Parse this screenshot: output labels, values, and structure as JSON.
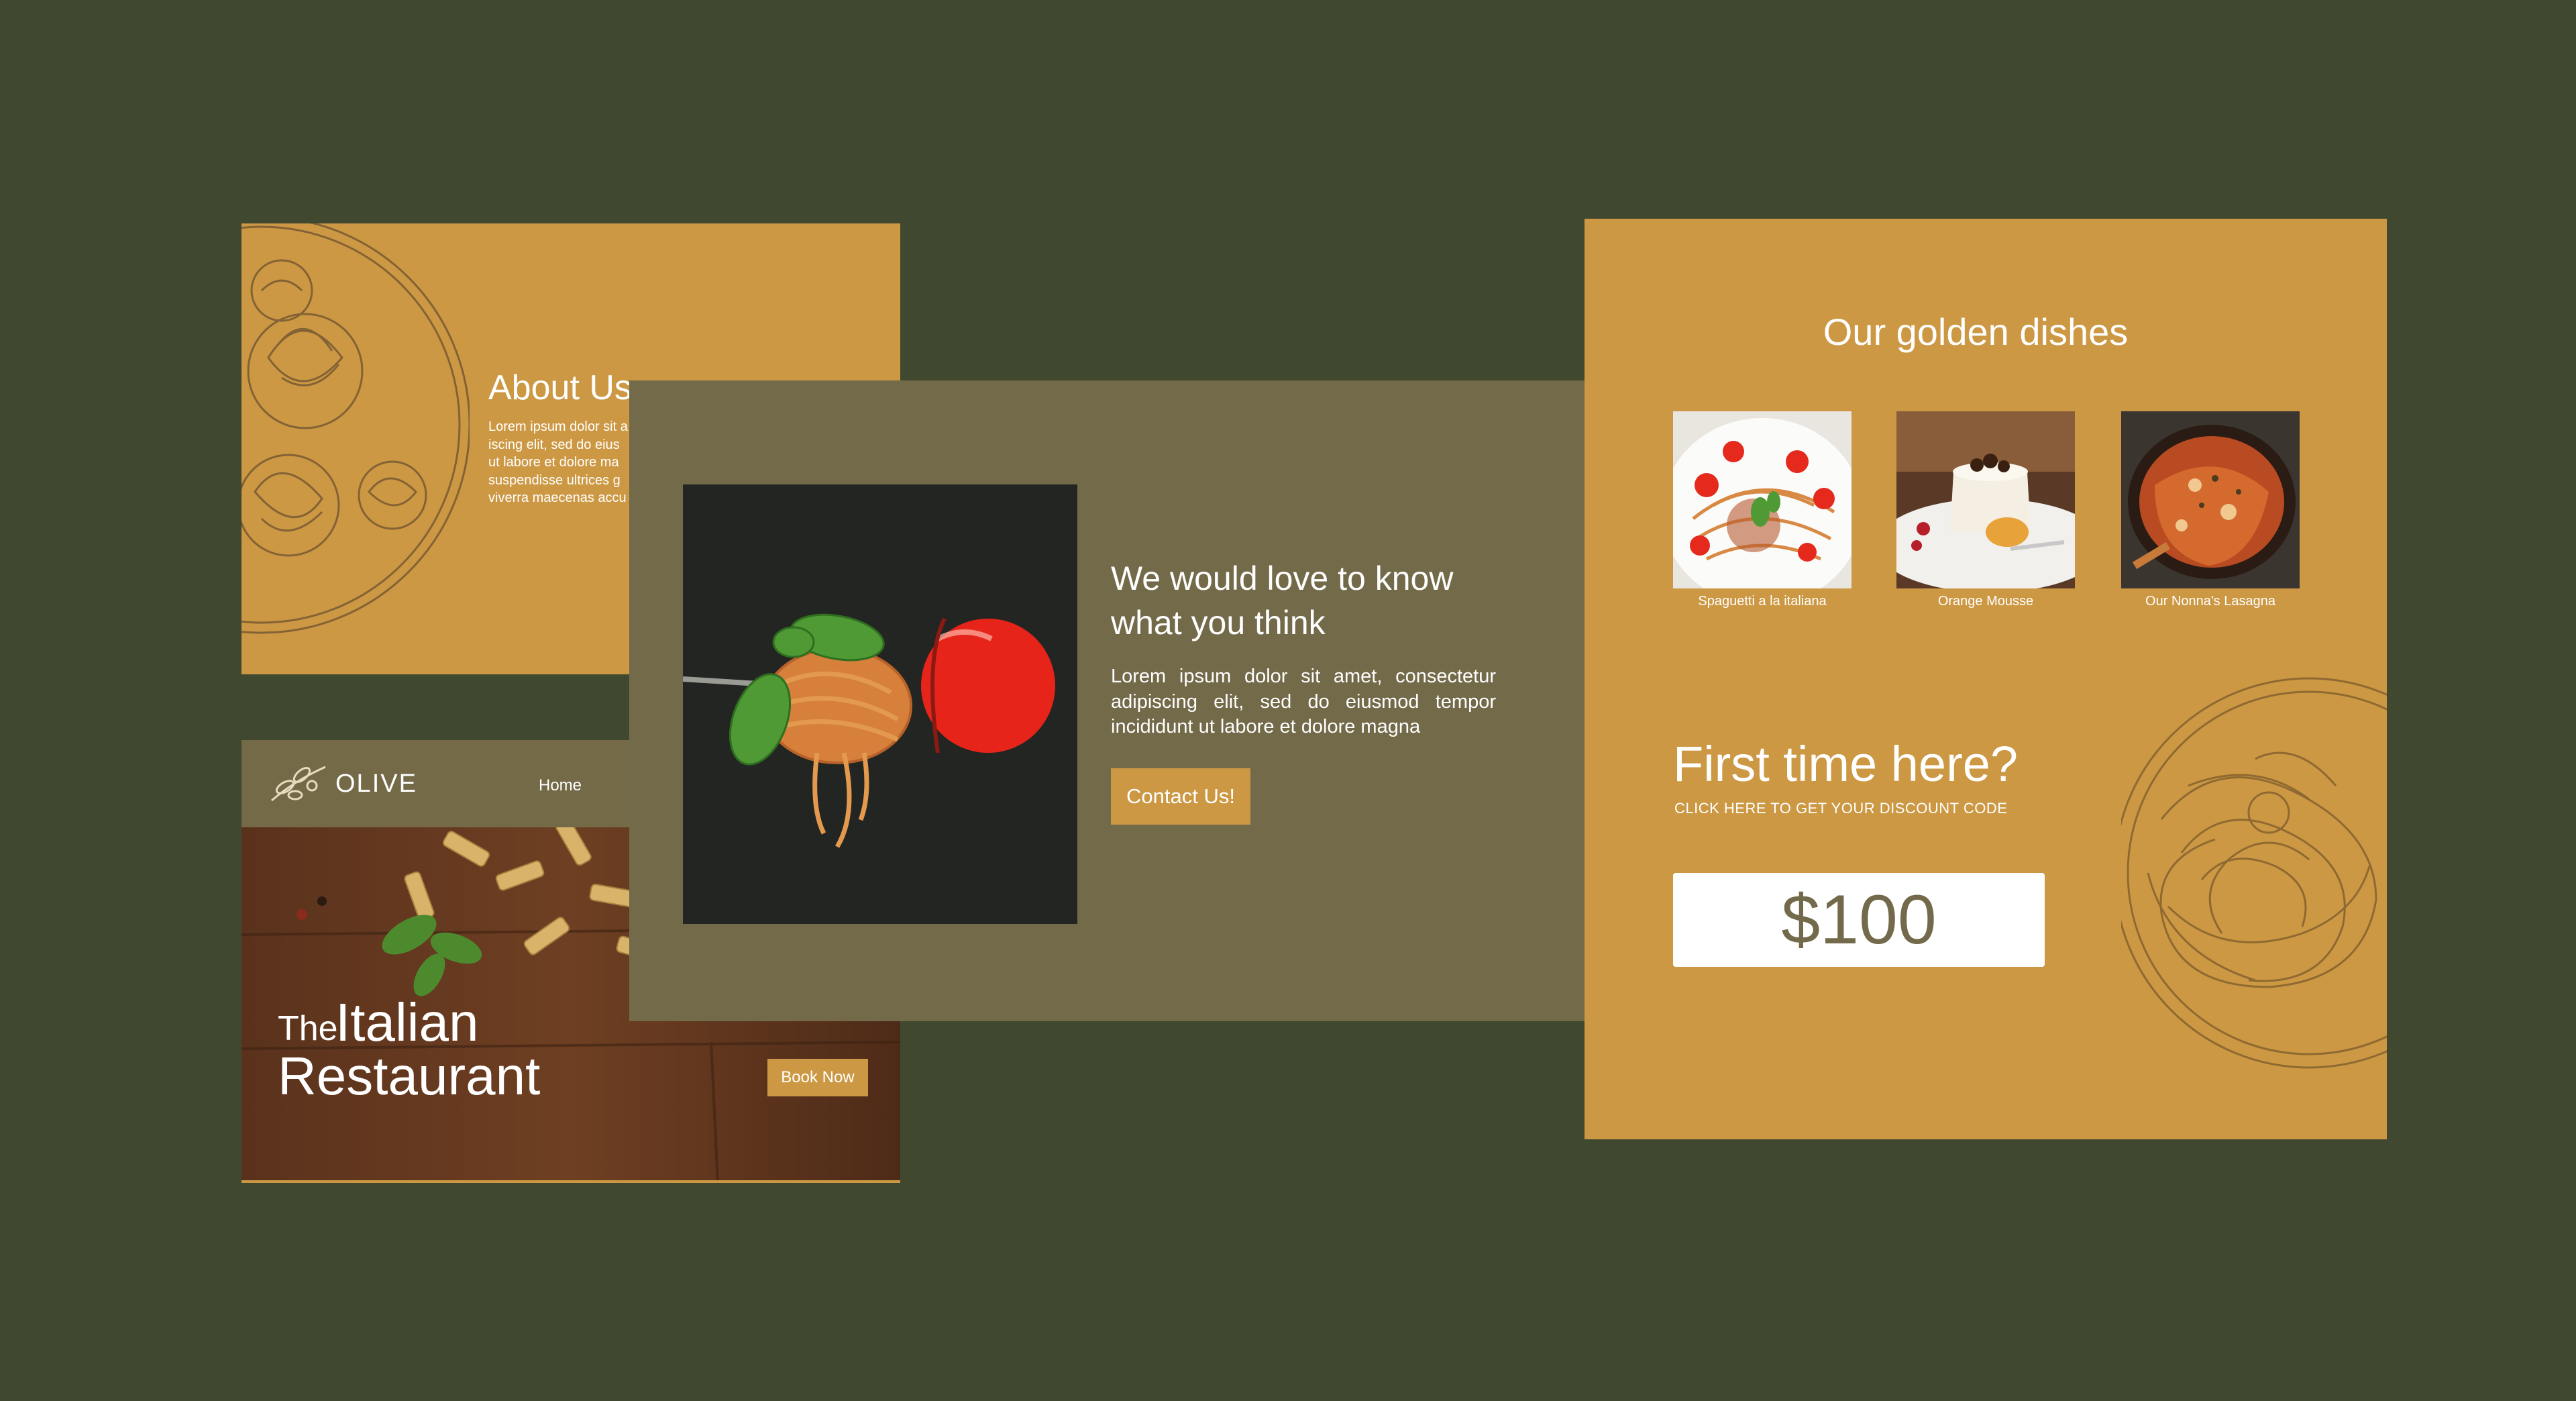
{
  "colors": {
    "background": "#414830",
    "gold": "#cd9843",
    "olive": "#736a49",
    "nav": "#746a48",
    "white": "#ffffff",
    "code_text": "#726a4a"
  },
  "about": {
    "title": "About Us",
    "body": "Lorem ipsum dolor sit a\niscing elit, sed do eius\nut labore et dolore ma\nsuspendisse ultrices g\nviverra maecenas accu"
  },
  "hero": {
    "brand": "OLIVE",
    "nav_home": "Home",
    "headline_small": "The",
    "headline_line1": "Italian",
    "headline_line2": "Restaurant",
    "book_button": "Book Now",
    "icons": [
      "olive-branch-icon"
    ]
  },
  "contact": {
    "heading": "We would love to know what you think",
    "text": "Lorem ipsum dolor sit amet, consectetur adipiscing elit, sed do eiusmod tempor incididunt ut labore et dolore magna",
    "button": "Contact Us!"
  },
  "dishes": {
    "title": "Our golden dishes",
    "items": [
      {
        "caption": "Spaguetti a la italiana"
      },
      {
        "caption": "Orange Mousse"
      },
      {
        "caption": "Our Nonna's Lasagna"
      }
    ],
    "first_time": "First time here?",
    "click_text": "CLICK HERE TO GET YOUR DISCOUNT CODE",
    "discount": "$100"
  }
}
